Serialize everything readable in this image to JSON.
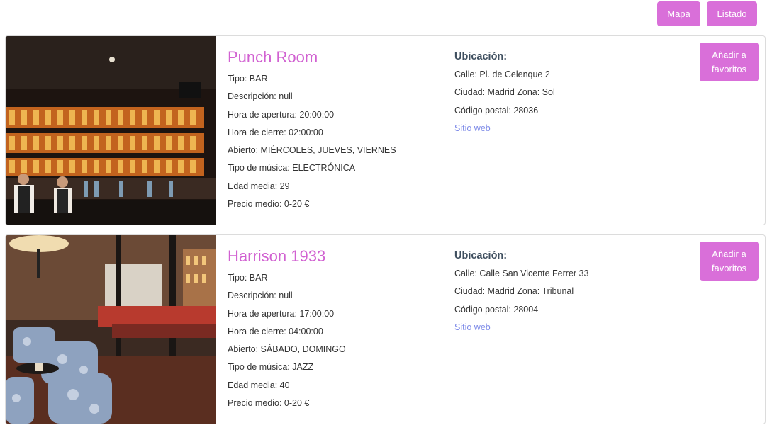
{
  "toolbar": {
    "map_label": "Mapa",
    "list_label": "Listado"
  },
  "accent_color": "#d96fd9",
  "venues": [
    {
      "name": "Punch Room",
      "type": "Tipo: BAR",
      "description": "Descripción: null",
      "opening": "Hora de apertura: 20:00:00",
      "closing": "Hora de cierre: 02:00:00",
      "open_days": "Abierto: MIÉRCOLES, JUEVES, VIERNES",
      "music": "Tipo de música: ELECTRÓNICA",
      "age": "Edad media: 29",
      "price": "Precio medio: 0-20 €",
      "location_title": "Ubicación:",
      "street": "Calle: Pl. de Celenque 2",
      "city": "Ciudad: Madrid Zona: Sol",
      "postal": "Código postal: 28036",
      "website": "Sitio web",
      "favorite_label": "Añadir a favoritos"
    },
    {
      "name": "Harrison 1933",
      "type": "Tipo: BAR",
      "description": "Descripción: null",
      "opening": "Hora de apertura: 17:00:00",
      "closing": "Hora de cierre: 04:00:00",
      "open_days": "Abierto: SÁBADO, DOMINGO",
      "music": "Tipo de música: JAZZ",
      "age": "Edad media: 40",
      "price": "Precio medio: 0-20 €",
      "location_title": "Ubicación:",
      "street": "Calle: Calle San Vicente Ferrer 33",
      "city": "Ciudad: Madrid Zona: Tribunal",
      "postal": "Código postal: 28004",
      "website": "Sitio web",
      "favorite_label": "Añadir a favoritos"
    }
  ]
}
